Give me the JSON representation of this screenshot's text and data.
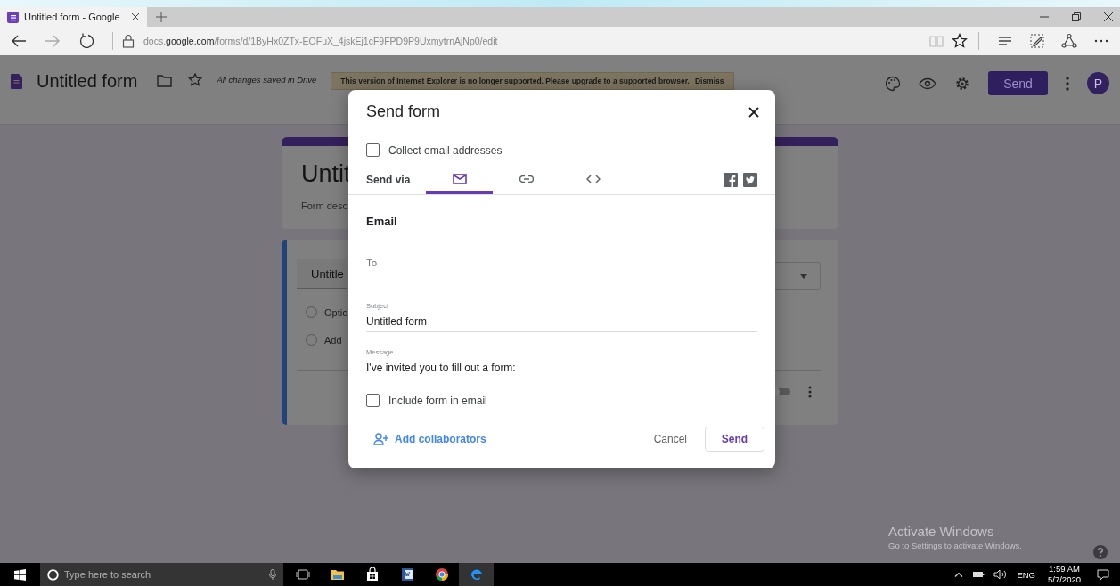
{
  "browser": {
    "tab_title": "Untitled form - Google",
    "url_prefix": "docs.",
    "url_domain": "google.com",
    "url_path": "/forms/d/1ByHx0ZTx-EOFuX_4jskEj1cF9FPD9P9UxmytrnAjNp0/edit"
  },
  "header": {
    "title": "Untitled form",
    "save_status": "All changes saved in Drive",
    "banner": {
      "text_before": "This version of Internet Explorer is no longer supported. Please upgrade to a ",
      "link": "supported browser",
      "text_after": ".",
      "dismiss": "Dismiss"
    },
    "send_button": "Send",
    "avatar": "P"
  },
  "form_behind": {
    "title": "Untit",
    "description": "Form desc",
    "question": "Untitle",
    "options": [
      {
        "label": "Optio",
        "selected": false
      },
      {
        "label": "Add",
        "selected": false
      }
    ],
    "required": {
      "on": false
    }
  },
  "dialog": {
    "title": "Send form",
    "collect_email": {
      "label": "Collect email addresses",
      "checked": false
    },
    "send_via": "Send via",
    "methods": [
      {
        "kind": "email",
        "selected": true
      },
      {
        "kind": "link",
        "selected": false
      },
      {
        "kind": "embed",
        "selected": false
      }
    ],
    "section": "Email",
    "to": {
      "placeholder": "To"
    },
    "subject": {
      "label": "Subject",
      "value": "Untitled form"
    },
    "message": {
      "label": "Message",
      "value": "I've invited you to fill out a form:"
    },
    "include_form": {
      "label": "Include form in email",
      "checked": false
    },
    "add_collaborators": "Add collaborators",
    "cancel": "Cancel",
    "send": "Send"
  },
  "activation_notice": {
    "title": "Activate Windows",
    "subtitle": "Go to Settings to activate Windows."
  },
  "taskbar": {
    "search_placeholder": "Type here to search",
    "language": "ENG",
    "time": "1:59 AM",
    "date": "5/7/2020"
  }
}
